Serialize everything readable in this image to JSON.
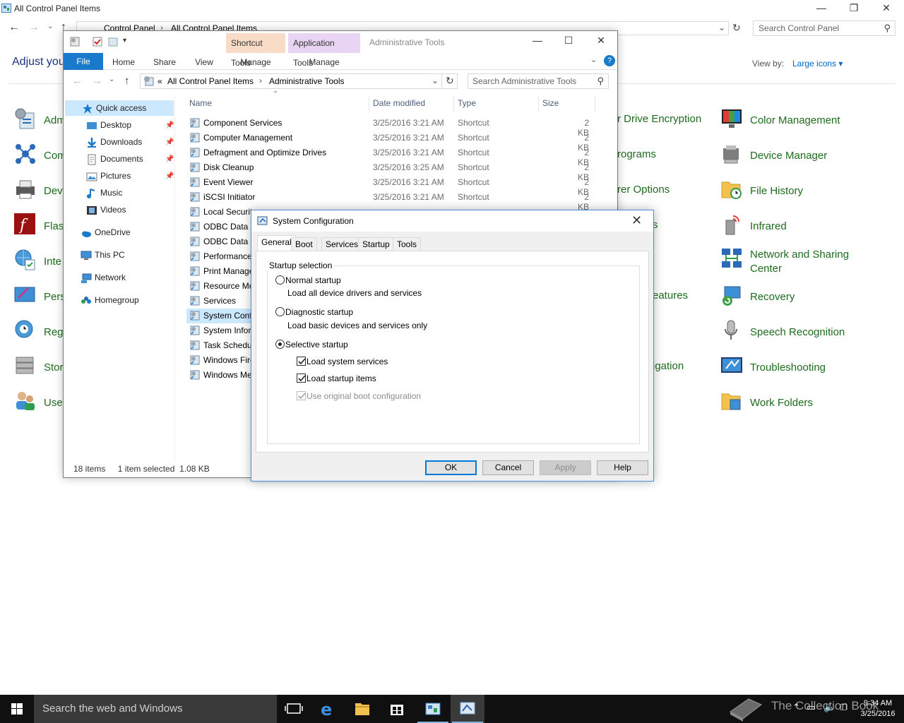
{
  "control_panel": {
    "window_title": "All Control Panel Items",
    "breadcrumb": [
      "Control Panel",
      "All Control Panel Items"
    ],
    "search_placeholder": "Search Control Panel",
    "heading": "Adjust you",
    "view_by_label": "View by:",
    "view_by_value": "Large icons",
    "left_items": [
      "Adm",
      "Com",
      "Dev",
      "Flas",
      "Inte",
      "Pers",
      "Reg",
      "Stor",
      "Use"
    ],
    "middle_items": [
      "r Drive Encryption",
      "rograms",
      "rer Options",
      "s",
      "eatures",
      "igation"
    ],
    "right_items": [
      "Color Management",
      "Device Manager",
      "File History",
      "Infrared",
      "Network and Sharing",
      "Center",
      "Recovery",
      "Speech Recognition",
      "Troubleshooting",
      "Work Folders"
    ]
  },
  "explorer": {
    "title": "Administrative Tools",
    "context_tabs": [
      "Shortcut Tools",
      "Application Tools"
    ],
    "ribbon_tabs": [
      "File",
      "Home",
      "Share",
      "View",
      "Manage",
      "Manage"
    ],
    "address": [
      "All Control Panel Items",
      "Administrative Tools"
    ],
    "address_prefix": "«",
    "search_placeholder": "Search Administrative Tools",
    "nav": [
      "Quick access",
      "Desktop",
      "Downloads",
      "Documents",
      "Pictures",
      "Music",
      "Videos",
      "OneDrive",
      "This PC",
      "Network",
      "Homegroup"
    ],
    "columns": [
      "Name",
      "Date modified",
      "Type",
      "Size"
    ],
    "files": [
      {
        "name": "Component Services",
        "date": "3/25/2016 3:21 AM",
        "type": "Shortcut",
        "size": "2 KB"
      },
      {
        "name": "Computer Management",
        "date": "3/25/2016 3:21 AM",
        "type": "Shortcut",
        "size": "2 KB"
      },
      {
        "name": "Defragment and Optimize Drives",
        "date": "3/25/2016 3:21 AM",
        "type": "Shortcut",
        "size": "2 KB"
      },
      {
        "name": "Disk Cleanup",
        "date": "3/25/2016 3:25 AM",
        "type": "Shortcut",
        "size": "2 KB"
      },
      {
        "name": "Event Viewer",
        "date": "3/25/2016 3:21 AM",
        "type": "Shortcut",
        "size": "2 KB"
      },
      {
        "name": "iSCSI Initiator",
        "date": "3/25/2016 3:21 AM",
        "type": "Shortcut",
        "size": "2 KB"
      },
      {
        "name": "Local Securit",
        "date": "",
        "type": "",
        "size": ""
      },
      {
        "name": "ODBC Data S",
        "date": "",
        "type": "",
        "size": ""
      },
      {
        "name": "ODBC Data S",
        "date": "",
        "type": "",
        "size": ""
      },
      {
        "name": "Performance",
        "date": "",
        "type": "",
        "size": ""
      },
      {
        "name": "Print Manage",
        "date": "",
        "type": "",
        "size": ""
      },
      {
        "name": "Resource Mo",
        "date": "",
        "type": "",
        "size": ""
      },
      {
        "name": "Services",
        "date": "",
        "type": "",
        "size": ""
      },
      {
        "name": "System Conf",
        "date": "",
        "type": "",
        "size": ""
      },
      {
        "name": "System Infor",
        "date": "",
        "type": "",
        "size": ""
      },
      {
        "name": "Task Schedul",
        "date": "",
        "type": "",
        "size": ""
      },
      {
        "name": "Windows Fire",
        "date": "",
        "type": "",
        "size": ""
      },
      {
        "name": "Windows Me",
        "date": "",
        "type": "",
        "size": ""
      }
    ],
    "status_items": "18 items",
    "status_selected": "1 item selected  1.08 KB"
  },
  "msconfig": {
    "title": "System Configuration",
    "tabs": [
      "General",
      "Boot",
      "Services",
      "Startup",
      "Tools"
    ],
    "group_title": "Startup selection",
    "normal_label": "Normal startup",
    "normal_desc": "Load all device drivers and services",
    "diagnostic_label": "Diagnostic startup",
    "diagnostic_desc": "Load basic devices and services only",
    "selective_label": "Selective startup",
    "selected_option": "selective",
    "load_system_services": "Load system services",
    "load_startup_items": "Load startup items",
    "use_original_boot": "Use original boot configuration",
    "buttons": [
      "OK",
      "Cancel",
      "Apply",
      "Help"
    ]
  },
  "taskbar": {
    "search_placeholder": "Search the web and Windows",
    "time": "9:34 AM",
    "date": "3/25/2016",
    "watermark": "The Collection Book"
  }
}
